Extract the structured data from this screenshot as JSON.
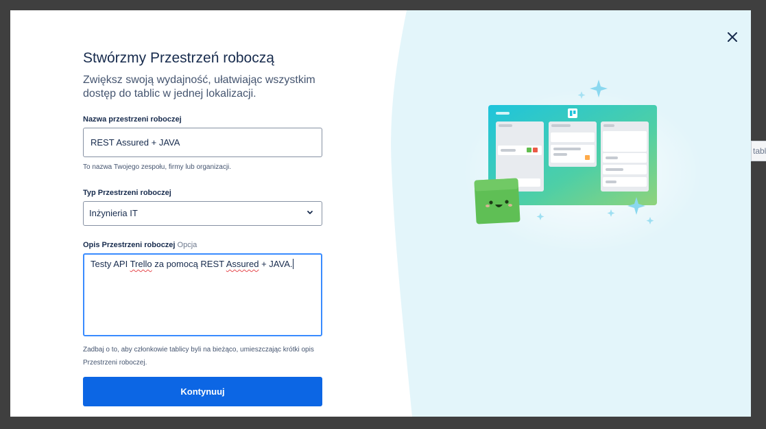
{
  "colors": {
    "accent": "#0c66e4",
    "panel_bg": "#e3f5fa",
    "focus": "#388bff"
  },
  "background": {
    "partial_text": "table"
  },
  "modal": {
    "title": "Stwórzmy Przestrzeń roboczą",
    "subtitle": "Zwiększ swoją wydajność, ułatwiając wszystkim dostęp do tablic w jednej lokalizacji.",
    "close_icon": "close-icon",
    "name_field": {
      "label": "Nazwa przestrzeni roboczej",
      "value": "REST Assured + JAVA",
      "help": "To nazwa Twojego zespołu, firmy lub organizacji."
    },
    "type_field": {
      "label": "Typ Przestrzeni roboczej",
      "selected": "Inżynieria IT",
      "icon": "chevron-down-icon"
    },
    "description_field": {
      "label": "Opis Przestrzeni roboczej",
      "optional": "Opcja",
      "value_parts": [
        "Testy API ",
        "Trello",
        " za pomocą REST ",
        "Assured",
        " + JAVA."
      ],
      "help": "Zadbaj o to, aby członkowie tablicy byli na bieżąco, umieszczając krótki opis Przestrzeni roboczej."
    },
    "submit_label": "Kontynuuj"
  }
}
